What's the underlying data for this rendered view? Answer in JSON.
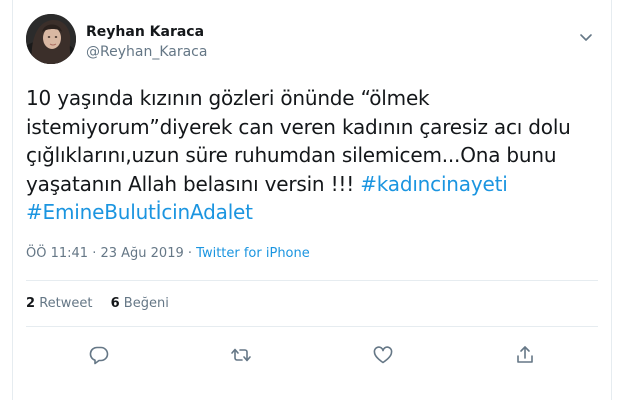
{
  "user": {
    "display_name": "Reyhan Karaca",
    "handle": "@Reyhan_Karaca"
  },
  "tweet": {
    "line1": "10 yaşında kızının gözleri önünde “ölmek",
    "line2": "istemiyorum”diyerek can veren kadının çaresiz acı dolu",
    "line3": "çığlıklarını,uzun süre ruhumdan silemicem...Ona bunu",
    "line4_text": "yaşatanın Allah belasını versin !!! ",
    "hashtag1": "#kadıncinayeti",
    "hashtag2": "#EmineBulutİcinAdalet"
  },
  "meta": {
    "time": "ÖÖ 11:41",
    "date": "23 Ağu 2019",
    "separator": " · ",
    "source": "Twitter for iPhone"
  },
  "stats": {
    "retweet_count": "2",
    "retweet_label": "Retweet",
    "like_count": "6",
    "like_label": "Beğeni"
  },
  "icons": {
    "more": "chevron-down-icon",
    "reply": "reply-icon",
    "retweet": "retweet-icon",
    "like": "heart-icon",
    "share": "share-icon"
  },
  "colors": {
    "link": "#1b95e0",
    "muted": "#657786",
    "text": "#14171a",
    "border": "#e6ecf0"
  }
}
